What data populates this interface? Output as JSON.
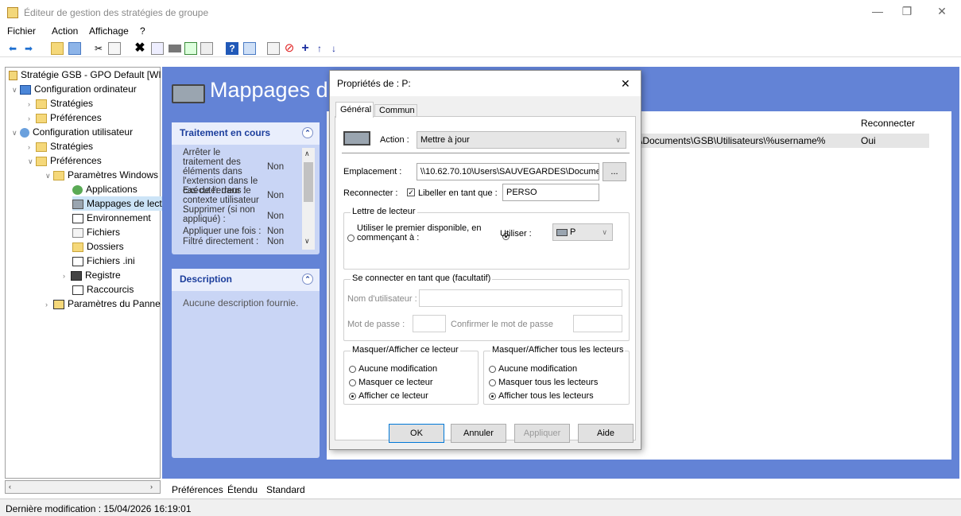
{
  "window": {
    "title": "Éditeur de gestion des stratégies de groupe",
    "minimize": "—",
    "restore": "❐",
    "close": "✕"
  },
  "menu": [
    "Fichier",
    "Action",
    "Affichage",
    "?"
  ],
  "tree": {
    "root": "Stratégie GSB - GPO Default [WI",
    "items": [
      {
        "label": "Configuration ordinateur"
      },
      {
        "label": "Stratégies"
      },
      {
        "label": "Préférences"
      },
      {
        "label": "Configuration utilisateur"
      },
      {
        "label": "Stratégies"
      },
      {
        "label": "Préférences"
      },
      {
        "label": "Paramètres Windows"
      },
      {
        "label": "Applications"
      },
      {
        "label": "Mappages de lect"
      },
      {
        "label": "Environnement"
      },
      {
        "label": "Fichiers"
      },
      {
        "label": "Dossiers"
      },
      {
        "label": "Fichiers .ini"
      },
      {
        "label": "Registre"
      },
      {
        "label": "Raccourcis"
      },
      {
        "label": "Paramètres du Panne"
      }
    ]
  },
  "main": {
    "heading": "Mappages d",
    "processing": {
      "title": "Traitement en cours",
      "rows": [
        {
          "label": "Arrêter le traitement des éléments dans l'extension dans le cas de l'erreur :",
          "value": "Non"
        },
        {
          "label": "Exécuter dans le contexte utilisateur :",
          "value": "Non"
        },
        {
          "label": "Supprimer (si non appliqué) :",
          "value": "Non"
        },
        {
          "label": "Appliquer une fois :",
          "value": "Non"
        },
        {
          "label": "Filtré directement :",
          "value": "Non"
        }
      ]
    },
    "description": {
      "title": "Description",
      "text": "Aucune description fournie."
    },
    "list": {
      "col_reconnect": "Reconnecter",
      "row_path": "\\Documents\\GSB\\Utilisateurs\\%username%",
      "row_reconnect": "Oui"
    }
  },
  "bottom_tabs": [
    "Préférences",
    "Étendu",
    "Standard"
  ],
  "status": {
    "text": "Dernière modification : 15/04/2026 16:19:01"
  },
  "dialog": {
    "title": "Propriétés de : P:",
    "close": "✕",
    "tabs": [
      "Général",
      "Commun"
    ],
    "action_label": "Action :",
    "action_value": "Mettre à jour",
    "location_label": "Emplacement :",
    "location_value": "\\\\10.62.70.10\\Users\\SAUVEGARDES\\Documen",
    "browse": "...",
    "reconnect_label": "Reconnecter :",
    "label_as": "Libeller en tant que :",
    "label_value": "PERSO",
    "drive_letter": {
      "group": "Lettre de lecteur",
      "first_available_line1": "Utiliser le premier disponible, en",
      "first_available_line2": "commençant à :",
      "use": "Utiliser :",
      "use_value": "P"
    },
    "connect_as": {
      "group": "Se connecter en tant que (facultatif)",
      "username": "Nom d'utilisateur :",
      "password": "Mot de passe :",
      "confirm": "Confirmer le mot de passe"
    },
    "hide_show_drive": {
      "group": "Masquer/Afficher ce lecteur",
      "options": [
        "Aucune modification",
        "Masquer ce lecteur",
        "Afficher ce lecteur"
      ]
    },
    "hide_show_all": {
      "group": "Masquer/Afficher tous les lecteurs",
      "options": [
        "Aucune modification",
        "Masquer tous les lecteurs",
        "Afficher tous les lecteurs"
      ]
    },
    "buttons": {
      "ok": "OK",
      "cancel": "Annuler",
      "apply": "Appliquer",
      "help": "Aide"
    }
  }
}
